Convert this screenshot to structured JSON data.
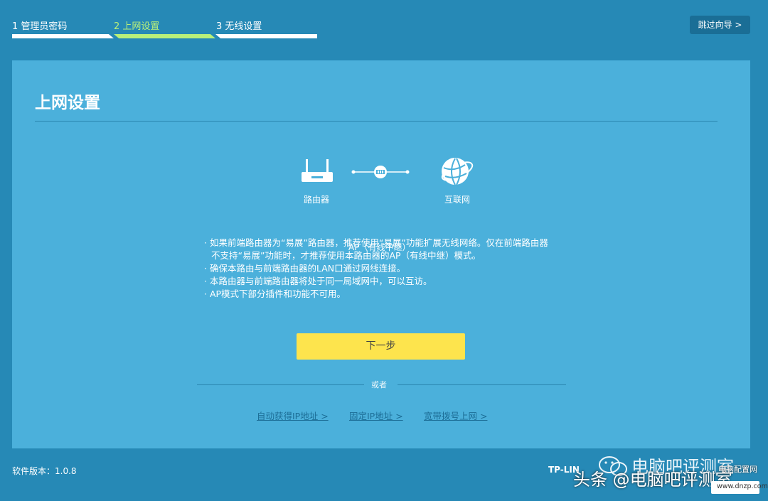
{
  "steps": [
    {
      "label": "1 管理员密码"
    },
    {
      "label": "2 上网设置"
    },
    {
      "label": "3 无线设置"
    }
  ],
  "skip_button": "跳过向导 >",
  "panel": {
    "title": "上网设置",
    "diagram": {
      "router_label": "路由器",
      "mode_label": "AP（有线中继）",
      "internet_label": "互联网",
      "icons": [
        "router-icon",
        "network-link-icon",
        "globe-icon"
      ]
    },
    "notes": [
      "· 如果前端路由器为“易展”路由器，推荐使用“易展”功能扩展无线网络。仅在前端路由器",
      "  不支持“易展”功能时，才推荐使用本路由器的AP（有线中继）模式。",
      "· 确保本路由与前端路由器的LAN口通过网线连接。",
      "· 本路由器与前端路由器将处于同一局域网中，可以互访。",
      "· AP模式下部分插件和功能不可用。"
    ],
    "next_button": "下一步",
    "or_text": "或者",
    "links": [
      "自动获得IP地址 >",
      "固定IP地址 >",
      "宽带拨号上网 >"
    ]
  },
  "footer": {
    "version": "软件版本：1.0.8",
    "brand": "TP-LIN"
  },
  "watermark": {
    "line1": "电脑吧评测室",
    "line2": "头条 @电脑吧评测室",
    "site": "电脑配置网",
    "url": "www.dnzp.com"
  },
  "colors": {
    "background": "#2689b6",
    "panel": "#4bb0db",
    "active_step": "#b9f07a",
    "primary_button": "#fde44d",
    "link": "#1c6d96"
  }
}
